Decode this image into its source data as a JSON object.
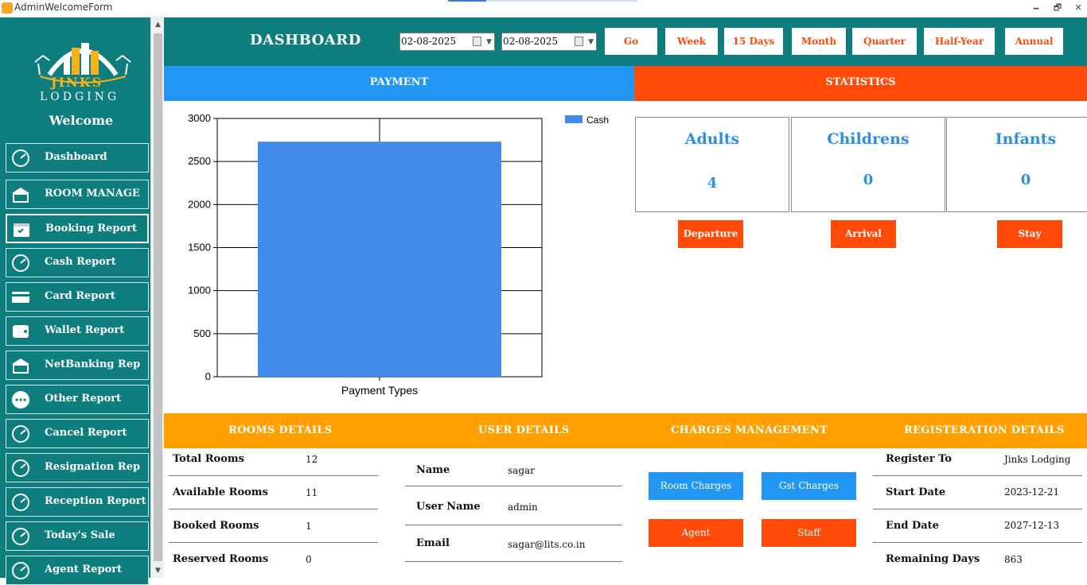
{
  "window": {
    "title": "AdminWelcomeForm",
    "minimize": "🗕",
    "maximize": "🗗",
    "close": "✕"
  },
  "sidebar": {
    "brand_line1": "JINKS",
    "brand_line2": "LODGING",
    "welcome": "Welcome",
    "items": [
      {
        "label": "Dashboard",
        "icon": "speedometer-icon"
      },
      {
        "label": "ROOM MANAGE",
        "icon": "hotel-icon"
      },
      {
        "label": "Booking Report",
        "icon": "calendar-check-icon"
      },
      {
        "label": "Cash Report",
        "icon": "cash-icon"
      },
      {
        "label": "Card Report",
        "icon": "credit-card-icon"
      },
      {
        "label": "Wallet Report",
        "icon": "wallet-icon"
      },
      {
        "label": "NetBanking Rep",
        "icon": "bank-icon"
      },
      {
        "label": "Other Report",
        "icon": "more-icon"
      },
      {
        "label": "Cancel Report",
        "icon": "cancel-chart-icon"
      },
      {
        "label": "Resignation Rep",
        "icon": "resignation-icon"
      },
      {
        "label": "Reception Report",
        "icon": "reception-icon"
      },
      {
        "label": "Today's Sale",
        "icon": "sale-icon"
      },
      {
        "label": "Agent Report",
        "icon": "agent-icon"
      }
    ],
    "active_index": 2
  },
  "header": {
    "title": "DASHBOARD",
    "date_from": "02-08-2025",
    "date_to": "02-08-2025",
    "buttons": [
      "Go",
      "Week",
      "15 Days",
      "Month",
      "Quarter",
      "Half-Year",
      "Annual"
    ]
  },
  "tabs": {
    "payment": "PAYMENT",
    "statistics": "STATISTICS"
  },
  "chart_data": {
    "type": "bar",
    "categories": [
      ""
    ],
    "series": [
      {
        "name": "Cash",
        "values": [
          2730
        ],
        "color": "#428bea"
      }
    ],
    "xlabel": "Payment Types",
    "ylabel": "",
    "ylim": [
      0,
      3000
    ],
    "yticks": [
      0,
      500,
      1000,
      1500,
      2000,
      2500,
      3000
    ],
    "grid": true,
    "legend": "top-right"
  },
  "statistics": {
    "cards": [
      {
        "label": "Adults",
        "value": "4"
      },
      {
        "label": "Childrens",
        "value": "0"
      },
      {
        "label": "Infants",
        "value": "0"
      }
    ],
    "buttons": [
      "Departure",
      "Arrival",
      "Stay"
    ]
  },
  "sections": {
    "rooms": {
      "title": "ROOMS DETAILS",
      "rows": [
        {
          "label": "Total Rooms",
          "value": "12"
        },
        {
          "label": "Available Rooms",
          "value": "11"
        },
        {
          "label": "Booked Rooms",
          "value": "1"
        },
        {
          "label": "Reserved Rooms",
          "value": "0"
        }
      ]
    },
    "user": {
      "title": "USER DETAILS",
      "rows": [
        {
          "label": "Name",
          "value": "sagar"
        },
        {
          "label": "User Name",
          "value": "admin"
        },
        {
          "label": "Email",
          "value": "sagar@lits.co.in"
        }
      ]
    },
    "charges": {
      "title": "CHARGES MANAGEMENT",
      "buttons": [
        "Room Charges",
        "Gst Charges",
        "Agent",
        "Staff"
      ]
    },
    "registration": {
      "title": "REGISTERATION DETAILS",
      "rows": [
        {
          "label": "Register To",
          "value": "Jinks Lodging"
        },
        {
          "label": "Start Date",
          "value": "2023-12-21"
        },
        {
          "label": "End Date",
          "value": "2027-12-13"
        },
        {
          "label": "Remaining Days",
          "value": "863"
        }
      ]
    }
  },
  "colors": {
    "teal": "#0e7d7d",
    "blue": "#2196f3",
    "orange_red": "#ff4a08",
    "amber": "#ffa000",
    "bar": "#428bea"
  }
}
